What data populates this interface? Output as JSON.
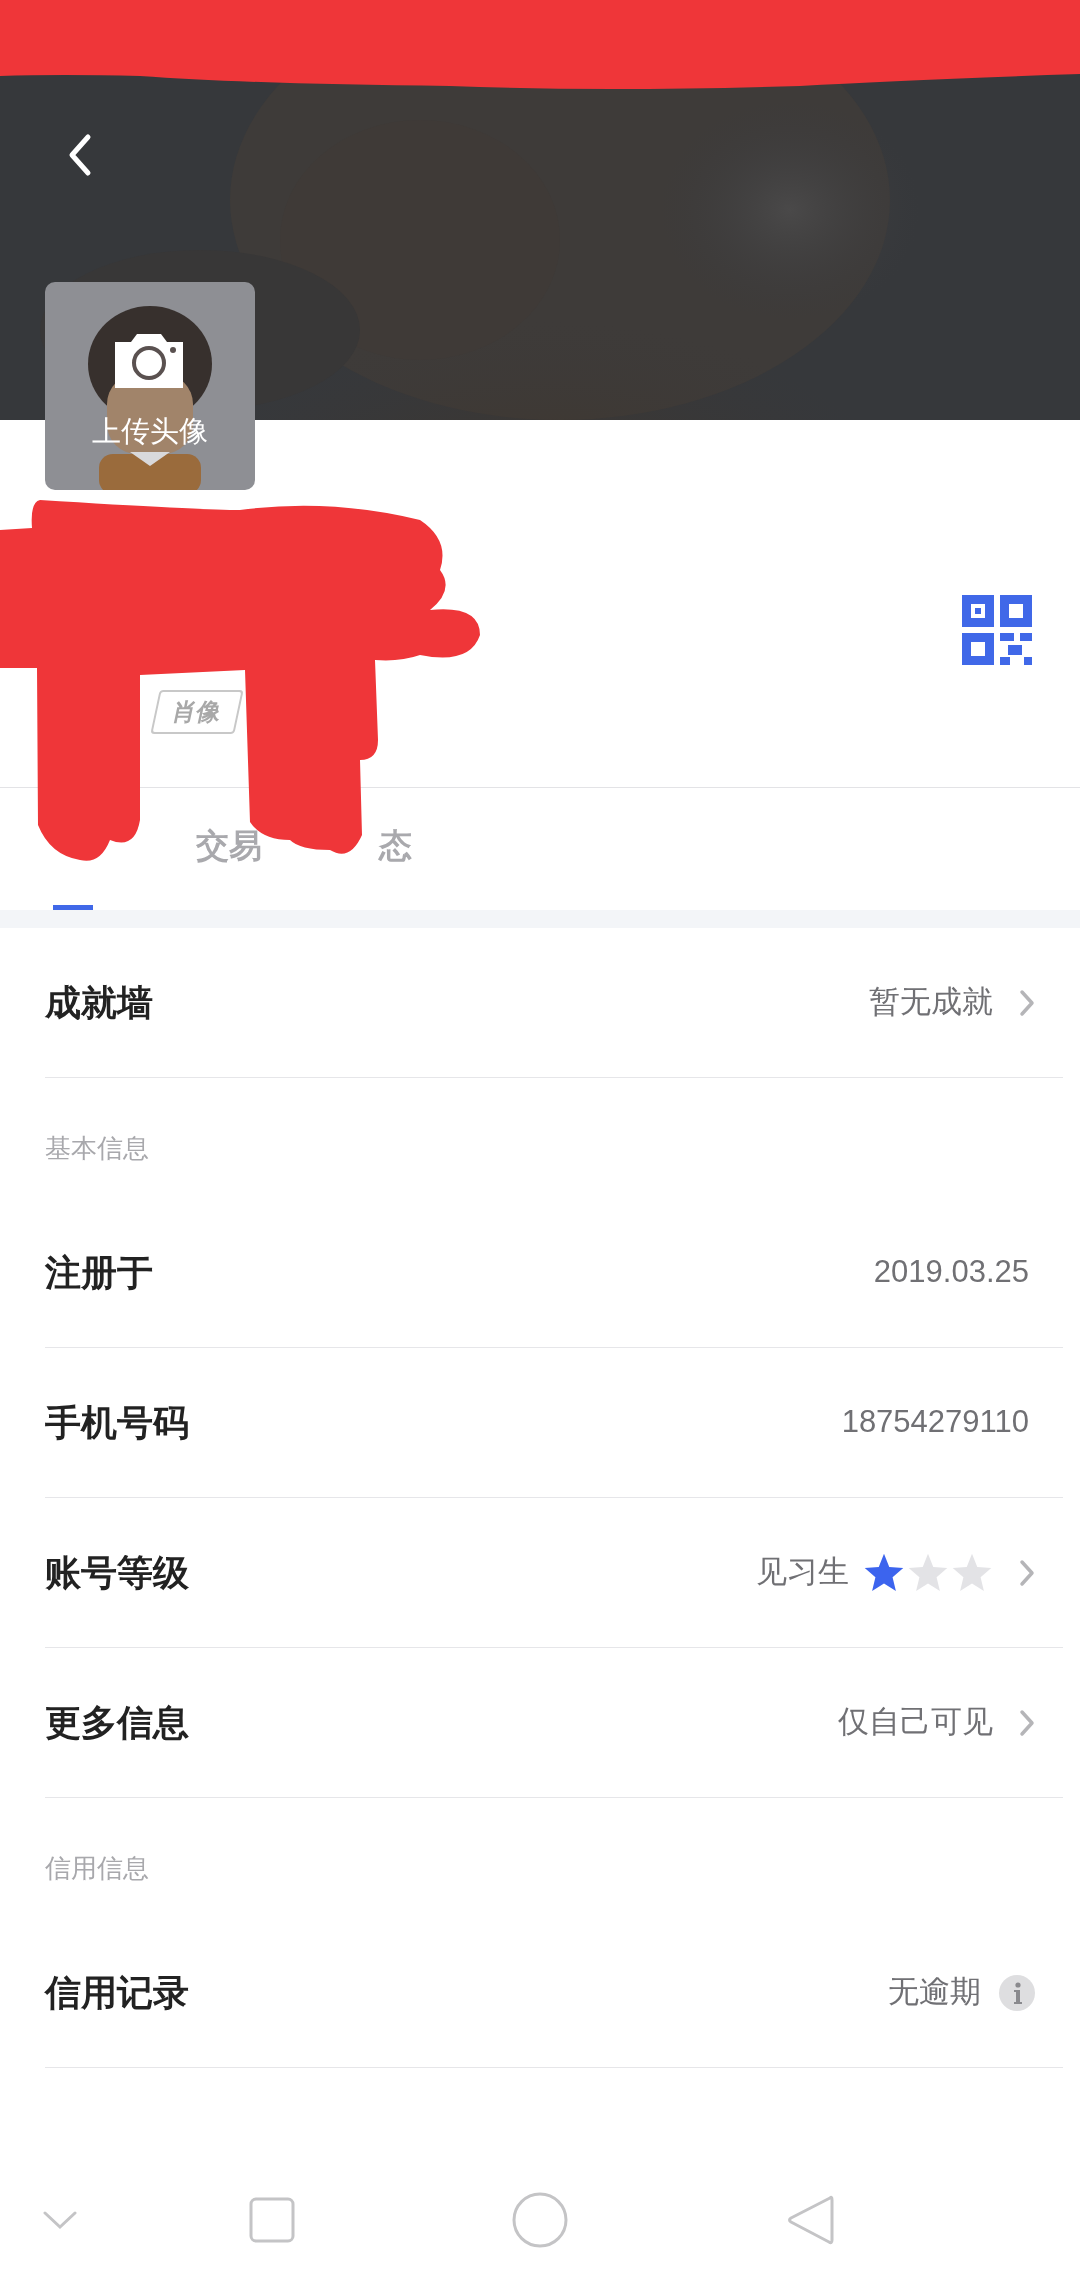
{
  "avatar_card": {
    "label": "上传头像"
  },
  "profile": {
    "tag": "肖像"
  },
  "tabs": [
    {
      "selected": true
    },
    {
      "label": "交易",
      "selected": false
    },
    {
      "label": "态",
      "selected": false
    }
  ],
  "rows": [
    {
      "kind": "link",
      "label": "成就墙",
      "value": "暂无成就"
    },
    {
      "kind": "heading",
      "label": "基本信息"
    },
    {
      "kind": "plain",
      "label": "注册于",
      "value": "2019.03.25"
    },
    {
      "kind": "plain",
      "label": "手机号码",
      "value": "18754279110"
    },
    {
      "kind": "stars",
      "label": "账号等级",
      "value": "见习生",
      "stars": 1
    },
    {
      "kind": "link",
      "label": "更多信息",
      "value": "仅自己可见"
    },
    {
      "kind": "heading",
      "label": "信用信息"
    },
    {
      "kind": "info",
      "label": "信用记录",
      "value": "无逾期"
    }
  ]
}
